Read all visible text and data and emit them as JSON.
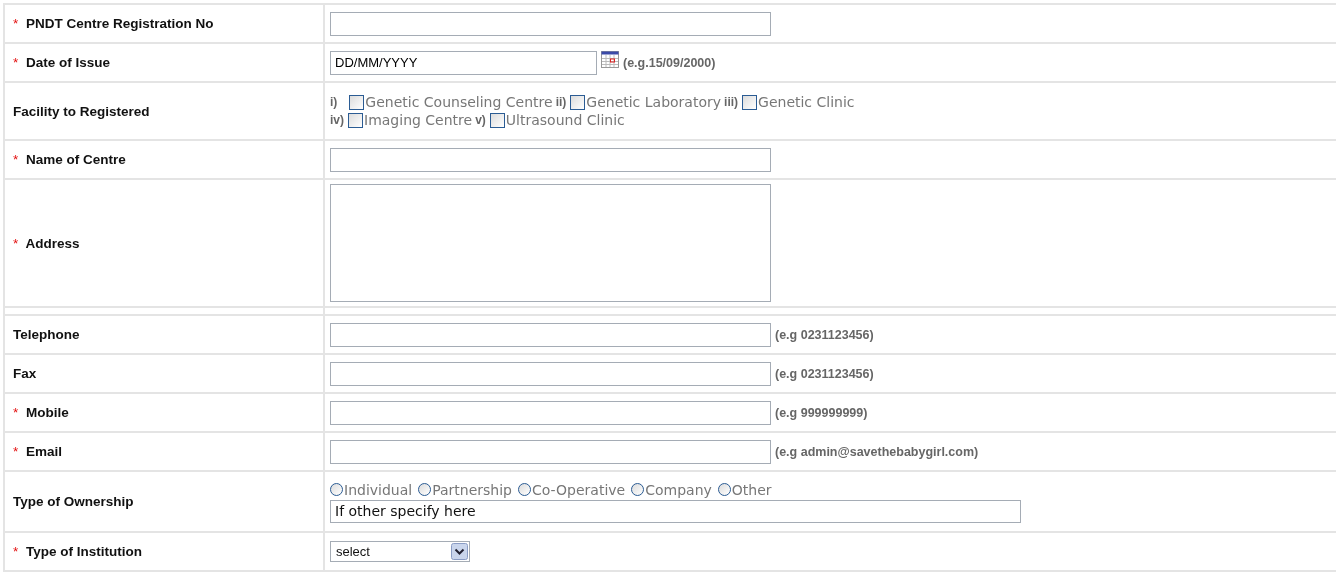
{
  "form": {
    "rows": [
      {
        "kind": "text",
        "label": "PNDT Centre Registration No",
        "mark": "*"
      },
      {
        "kind": "date",
        "label": "Date of Issue",
        "mark": "*",
        "value": "DD/MM/YYYY",
        "hint": "(e.g.15/09/2000)"
      },
      {
        "kind": "checkboxes",
        "label": "Facility to Registered",
        "options": [
          {
            "prefix": "i)",
            "label": "Genetic Counseling Centre",
            "checked": false
          },
          {
            "prefix": "ii)",
            "label": "Genetic Laboratory",
            "checked": false
          },
          {
            "prefix": "iii)",
            "label": "Genetic Clinic",
            "checked": false
          },
          {
            "prefix": "iv)",
            "label": "Imaging Centre",
            "checked": false
          },
          {
            "prefix": "v)",
            "label": "Ultrasound Clinic",
            "checked": false
          }
        ]
      },
      {
        "kind": "text",
        "label": "Name of Centre",
        "mark": "*"
      },
      {
        "kind": "textarea",
        "label": "Address",
        "mark": "*"
      },
      {
        "kind": "spacer"
      },
      {
        "kind": "text",
        "label": "Telephone",
        "hint": "(e.g 0231123456)"
      },
      {
        "kind": "text",
        "label": "Fax",
        "hint": "(e.g 0231123456)"
      },
      {
        "kind": "text",
        "label": "Mobile",
        "mark": "*",
        "hint": "(e.g 999999999)"
      },
      {
        "kind": "text",
        "label": "Email",
        "mark": "*",
        "hint": "(e.g admin@savethebabygirl.com)"
      },
      {
        "kind": "radios",
        "label": "Type of Ownership",
        "options": [
          {
            "label": "Individual",
            "selected": false
          },
          {
            "label": "Partnership",
            "selected": false
          },
          {
            "label": "Co-Operative",
            "selected": false
          },
          {
            "label": "Company",
            "selected": false
          },
          {
            "label": "Other",
            "selected": false
          }
        ],
        "value": "If other specify here"
      },
      {
        "kind": "select",
        "label": "Type of Institution",
        "mark": "*",
        "value": "select"
      }
    ]
  }
}
